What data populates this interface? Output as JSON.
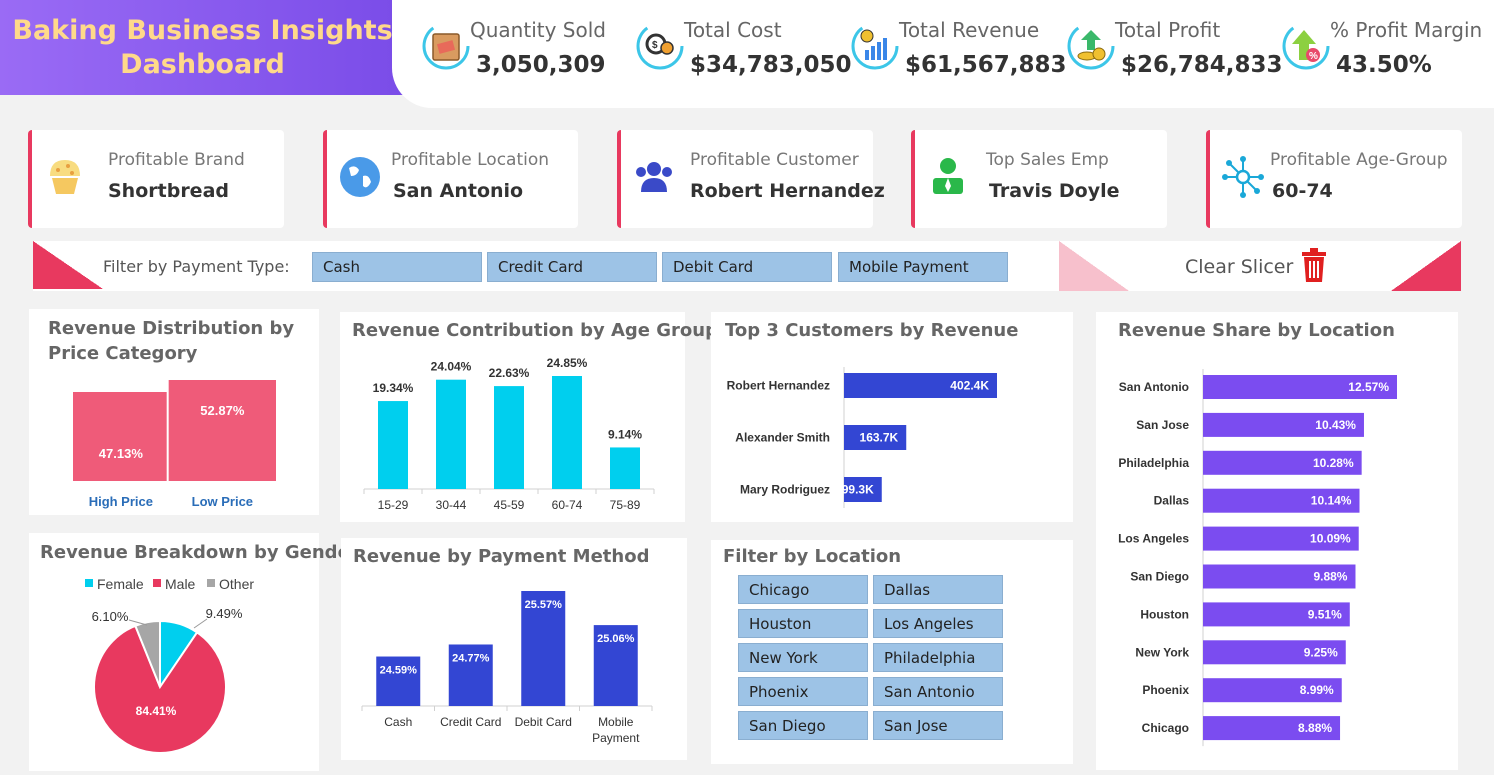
{
  "header": {
    "title_line1": "Baking Business Insights",
    "title_line2": "Dashboard"
  },
  "kpis": [
    {
      "label": "Quantity Sold",
      "value": "3,050,309",
      "icon": "package-icon"
    },
    {
      "label": "Total Cost",
      "value": "$34,783,050",
      "icon": "gears-cost-icon"
    },
    {
      "label": "Total Revenue",
      "value": "$61,567,883",
      "icon": "revenue-chart-icon"
    },
    {
      "label": "Total Profit",
      "value": "$26,784,833",
      "icon": "profit-coins-icon"
    },
    {
      "label": "% Profit Margin",
      "value": "43.50%",
      "icon": "margin-arrow-icon"
    }
  ],
  "cards": [
    {
      "label": "Profitable Brand",
      "value": "Shortbread",
      "icon": "cupcake-icon"
    },
    {
      "label": "Profitable Location",
      "value": "San Antonio",
      "icon": "globe-icon"
    },
    {
      "label": "Profitable Customer",
      "value": "Robert Hernandez",
      "icon": "customers-icon"
    },
    {
      "label": "Top Sales Emp",
      "value": "Travis Doyle",
      "icon": "employee-icon"
    },
    {
      "label": "Profitable Age-Group",
      "value": "60-74",
      "icon": "network-icon"
    }
  ],
  "payment_filter": {
    "label": "Filter by Payment Type:",
    "options": [
      "Cash",
      "Credit Card",
      "Debit Card",
      "Mobile Payment"
    ],
    "clear_label": "Clear Slicer"
  },
  "location_filter": {
    "title": "Filter by Location",
    "options": [
      "Chicago",
      "Dallas",
      "Houston",
      "Los Angeles",
      "New York",
      "Philadelphia",
      "Phoenix",
      "San Antonio",
      "San Diego",
      "San Jose"
    ]
  },
  "colors": {
    "accent": "#e8395f",
    "purple": "#7a4ce8",
    "cyan": "#00cfee",
    "blue": "#3346d3",
    "violet": "#7b4cf0",
    "slicer": "#9dc3e6"
  },
  "chart_data": [
    {
      "id": "price",
      "type": "treemap",
      "title": "Revenue Distribution by Price Category",
      "categories": [
        "High Price",
        "Low Price"
      ],
      "values": [
        47.13,
        52.87
      ],
      "labels": [
        "47.13%",
        "52.87%"
      ]
    },
    {
      "id": "age",
      "type": "bar",
      "title": "Revenue Contribution by Age Group",
      "categories": [
        "15-29",
        "30-44",
        "45-59",
        "60-74",
        "75-89"
      ],
      "values": [
        19.34,
        24.04,
        22.63,
        24.85,
        9.14
      ],
      "labels": [
        "19.34%",
        "24.04%",
        "22.63%",
        "24.85%",
        "9.14%"
      ]
    },
    {
      "id": "customers",
      "type": "bar",
      "orientation": "horizontal",
      "title": "Top 3 Customers by Revenue",
      "categories": [
        "Robert Hernandez",
        "Alexander Smith",
        "Mary Rodriguez"
      ],
      "values": [
        402.4,
        163.7,
        99.3
      ],
      "labels": [
        "402.4K",
        "163.7K",
        "99.3K"
      ]
    },
    {
      "id": "locations",
      "type": "bar",
      "orientation": "horizontal",
      "title": "Revenue Share by Location",
      "categories": [
        "San Antonio",
        "San Jose",
        "Philadelphia",
        "Dallas",
        "Los Angeles",
        "San Diego",
        "Houston",
        "New York",
        "Phoenix",
        "Chicago"
      ],
      "values": [
        12.57,
        10.43,
        10.28,
        10.14,
        10.09,
        9.88,
        9.51,
        9.25,
        8.99,
        8.88
      ],
      "labels": [
        "12.57%",
        "10.43%",
        "10.28%",
        "10.14%",
        "10.09%",
        "9.88%",
        "9.51%",
        "9.25%",
        "8.99%",
        "8.88%"
      ]
    },
    {
      "id": "gender",
      "type": "pie",
      "title": "Revenue Breakdown by Gender",
      "categories": [
        "Female",
        "Male",
        "Other"
      ],
      "values": [
        9.49,
        84.41,
        6.1
      ],
      "labels": [
        "9.49%",
        "84.41%",
        "6.10%"
      ],
      "colors": [
        "#00cfee",
        "#e8395f",
        "#a6a6a6"
      ],
      "legend": "top"
    },
    {
      "id": "payment",
      "type": "bar",
      "title": "Revenue by Payment Method",
      "categories": [
        "Cash",
        "Credit Card",
        "Debit Card",
        "Mobile Payment"
      ],
      "values": [
        24.59,
        24.77,
        25.57,
        25.06
      ],
      "labels": [
        "24.59%",
        "24.77%",
        "25.57%",
        "25.06%"
      ]
    }
  ]
}
